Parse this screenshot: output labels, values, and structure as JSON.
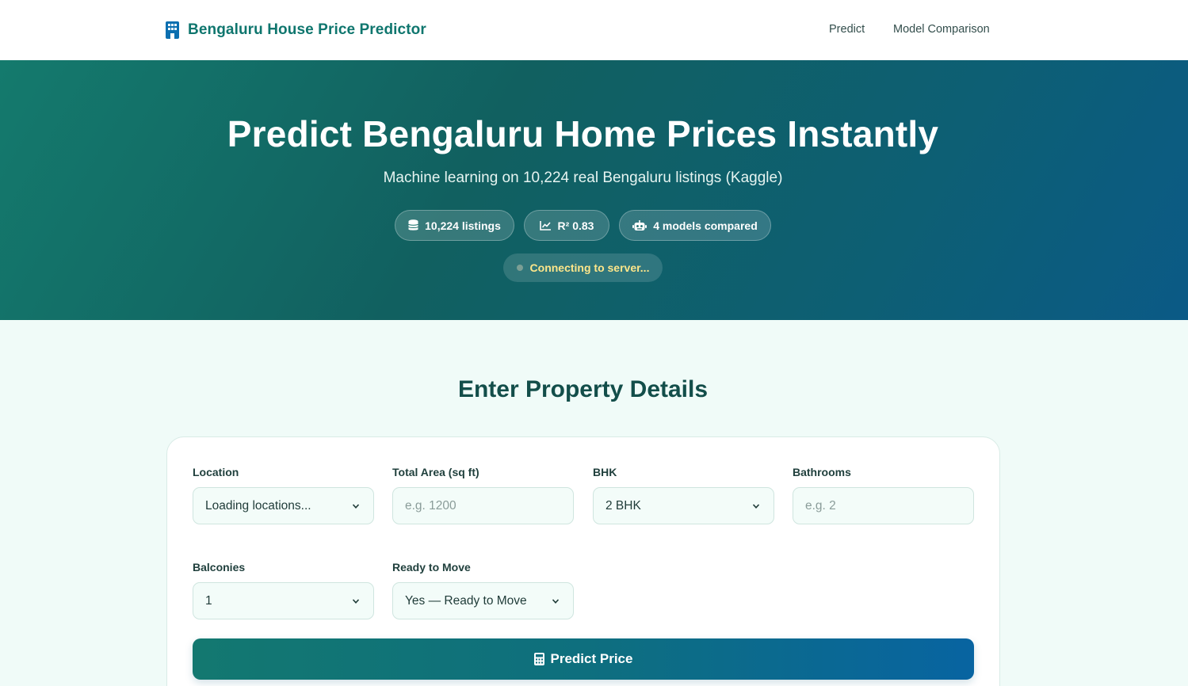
{
  "nav": {
    "brand": "Bengaluru House Price Predictor",
    "brand_icon": "building-icon",
    "links": [
      "Predict",
      "Model Comparison"
    ]
  },
  "hero": {
    "title": "Predict Bengaluru Home Prices Instantly",
    "subtitle": "Machine learning on 10,224 real Bengaluru listings (Kaggle)",
    "pills": [
      {
        "icon": "database-icon",
        "label": "10,224 listings"
      },
      {
        "icon": "chart-line-icon",
        "label": "R² 0.83"
      },
      {
        "icon": "robot-icon",
        "label": "4 models compared"
      }
    ],
    "status": "Connecting to server..."
  },
  "form": {
    "title": "Enter Property Details",
    "location": {
      "label": "Location",
      "value": "Loading locations..."
    },
    "area": {
      "label": "Total Area (sq ft)",
      "placeholder": "e.g. 1200"
    },
    "bhk": {
      "label": "BHK",
      "value": "2 BHK"
    },
    "bathrooms": {
      "label": "Bathrooms",
      "placeholder": "e.g. 2"
    },
    "balconies": {
      "label": "Balconies",
      "value": "1"
    },
    "ready": {
      "label": "Ready to Move",
      "value": "Yes — Ready to Move"
    },
    "submit": "Predict Price"
  },
  "colors": {
    "primary": "#0f766e",
    "accent_blue": "#0864a1",
    "status_text": "#fde68a"
  }
}
